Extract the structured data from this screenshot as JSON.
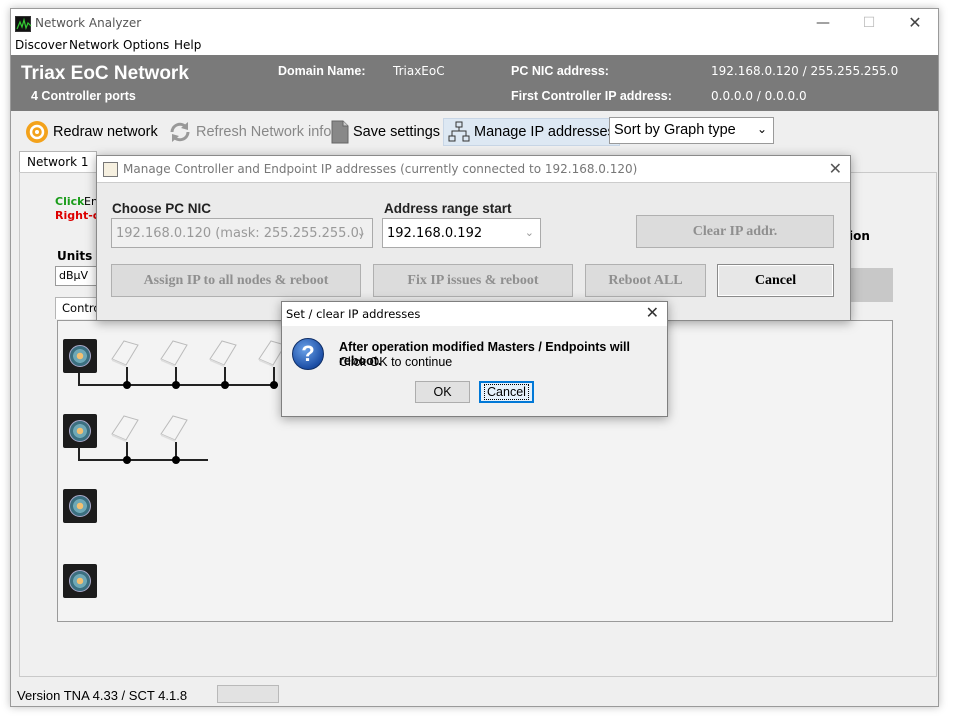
{
  "window": {
    "title": "Network Analyzer",
    "minimize": "—",
    "maximize": "☐",
    "close": "✕"
  },
  "menu": [
    "Discover",
    "Network",
    "Options",
    "Help"
  ],
  "header": {
    "title": "Triax EoC Network",
    "subtitle": "4 Controller ports",
    "domain_label": "Domain Name:",
    "domain_value": "TriaxEoC",
    "pc_nic_label": "PC NIC address:",
    "pc_nic_value": "192.168.0.120 / 255.255.255.0",
    "first_ctrl_label": "First Controller IP address:",
    "first_ctrl_value": "0.0.0.0 / 0.0.0.0"
  },
  "toolbar": {
    "redraw": "Redraw network",
    "refresh": "Refresh Network info",
    "save": "Save settings",
    "manage_ip": "Manage IP addresses",
    "sort_value": "Sort by Graph type"
  },
  "tabs": {
    "network": "Network 1",
    "inner": "Control"
  },
  "panel": {
    "hint_click": "Click",
    "hint_rest": "En",
    "hint_right": "Right-c",
    "units_label": "Units",
    "units_value": "dBµV",
    "right_label": "ion"
  },
  "status": {
    "version": "Version  TNA 4.33 / SCT 4.1.8"
  },
  "manage_dialog": {
    "title": "Manage Controller and Endpoint IP addresses (currently connected to 192.168.0.120)",
    "choose_nic_label": "Choose PC NIC",
    "choose_nic_value": "192.168.0.120 (mask: 255.255.255.0)",
    "range_label": "Address range start",
    "range_value": "192.168.0.192",
    "clear_btn": "Clear IP addr.",
    "assign_btn": "Assign IP to all nodes & reboot",
    "fix_btn": "Fix IP issues & reboot",
    "reboot_btn": "Reboot ALL",
    "cancel_btn": "Cancel",
    "close": "✕"
  },
  "confirm_dialog": {
    "title": "Set / clear IP addresses",
    "message_bold": "After operation modified Masters / Endpoints will reboot.",
    "message": "Click OK to continue",
    "ok": "OK",
    "cancel": "Cancel",
    "close": "✕",
    "icon_glyph": "?"
  },
  "topology": {
    "controllers": 4,
    "nodes_per_controller": [
      4,
      2,
      0,
      0
    ]
  }
}
